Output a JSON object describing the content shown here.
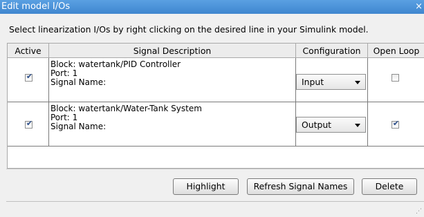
{
  "window": {
    "title": "Edit model I/Os",
    "close_glyph": "×"
  },
  "instructions": "Select linearization I/Os by right clicking on the desired line in your Simulink model.",
  "table": {
    "columns": [
      "Active",
      "Signal Description",
      "Configuration",
      "Open Loop"
    ],
    "rows": [
      {
        "active": true,
        "block": "Block: watertank/PID Controller",
        "port": "Port: 1",
        "signal_name": "Signal Name:",
        "configuration": "Input",
        "open_loop": false
      },
      {
        "active": true,
        "block": "Block: watertank/Water-Tank System",
        "port": "Port: 1",
        "signal_name": "Signal Name:",
        "configuration": "Output",
        "open_loop": true
      }
    ]
  },
  "buttons": {
    "highlight": "Highlight",
    "refresh": "Refresh Signal Names",
    "delete": "Delete"
  },
  "icons": {
    "checkmark": "checkmark-icon",
    "dropdown": "chevron-down-icon",
    "resize": "resize-grip-icon",
    "close": "close-icon"
  },
  "colors": {
    "titlebar": "#4a90d4",
    "check": "#2a4d8a"
  }
}
